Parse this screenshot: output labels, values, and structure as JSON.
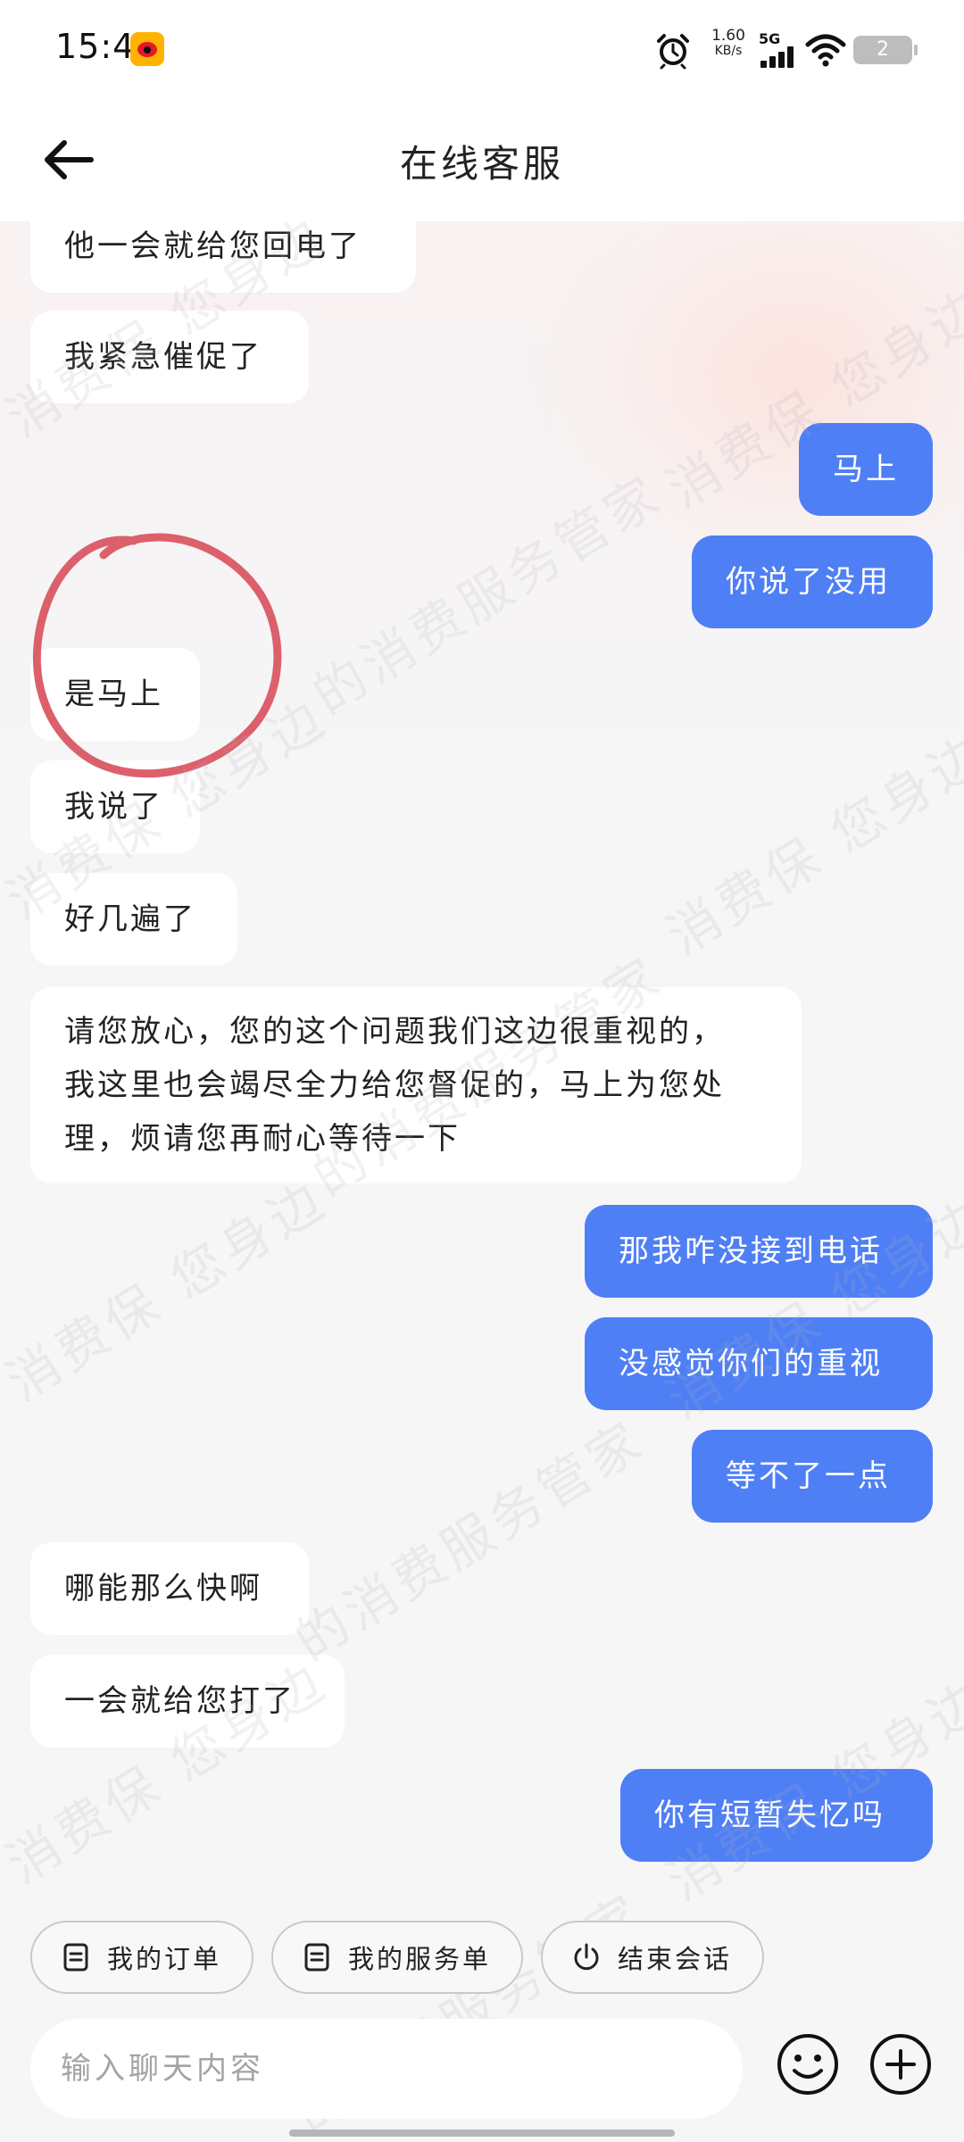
{
  "status_bar": {
    "time": "15:44",
    "net_speed_value": "1.60",
    "net_speed_unit": "KB/s",
    "network_type": "5G",
    "battery_level": "2"
  },
  "header": {
    "title": "在线客服"
  },
  "messages": [
    {
      "sender": "agent",
      "text": "他一会就给您回电了"
    },
    {
      "sender": "agent",
      "text": "我紧急催促了"
    },
    {
      "sender": "user",
      "text": "马上"
    },
    {
      "sender": "user",
      "text": "你说了没用"
    },
    {
      "sender": "agent",
      "text": "是马上"
    },
    {
      "sender": "agent",
      "text": "我说了"
    },
    {
      "sender": "agent",
      "text": "好几遍了"
    },
    {
      "sender": "agent",
      "lines": [
        "请您放心，您的这个问题我们这边很重视的，",
        "我这里也会竭尽全力给您督促的，马上为您处",
        "理，烦请您再耐心等待一下"
      ]
    },
    {
      "sender": "user",
      "text": "那我咋没接到电话"
    },
    {
      "sender": "user",
      "text": "没感觉你们的重视"
    },
    {
      "sender": "user",
      "text": "等不了一点"
    },
    {
      "sender": "agent",
      "text": "哪能那么快啊"
    },
    {
      "sender": "agent",
      "text": "一会就给您打了"
    },
    {
      "sender": "user",
      "text": "你有短暂失忆吗"
    }
  ],
  "watermark": {
    "text": "消费保 您身边的消费服务管家"
  },
  "quick_actions": [
    {
      "label": "我的订单",
      "icon": "order-icon"
    },
    {
      "label": "我的服务单",
      "icon": "service-order-icon"
    },
    {
      "label": "结束会话",
      "icon": "power-icon"
    }
  ],
  "input": {
    "placeholder": "输入聊天内容",
    "value": ""
  },
  "colors": {
    "user_bubble": "#4f7ff5",
    "agent_bubble": "#ffffff",
    "annotation": "#d9535e"
  }
}
